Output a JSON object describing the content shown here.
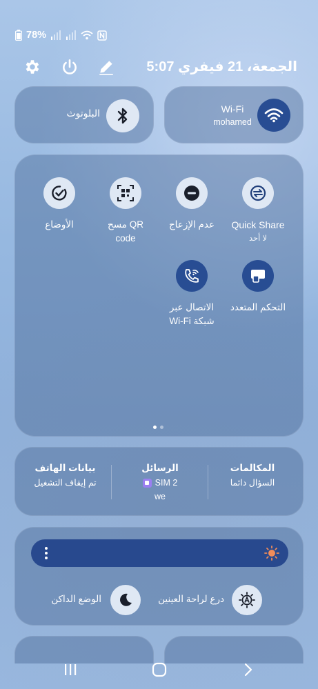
{
  "status_bar": {
    "battery": "78%",
    "icons": [
      "battery-icon",
      "signal-icon",
      "signal-icon",
      "wifi-icon",
      "nfc-icon"
    ]
  },
  "header": {
    "datetime": "5:07 الجمعة، 21 فيفري",
    "icons": [
      "settings-icon",
      "power-icon",
      "edit-icon"
    ]
  },
  "wifi_tile": {
    "label": "Wi-Fi",
    "network": "mohamed",
    "icon": "wifi-icon"
  },
  "bluetooth_tile": {
    "label": "البلوتوث",
    "icon": "bluetooth-icon"
  },
  "tiles": [
    {
      "label": "Quick Share",
      "sub": "لا أحد",
      "icon": "quick-share-icon"
    },
    {
      "label": "عدم الإزعاج",
      "icon": "do-not-disturb-icon"
    },
    {
      "label": "مسح QR",
      "label2": "code",
      "icon": "qr-code-icon"
    },
    {
      "label": "الأوضاع",
      "icon": "modes-icon"
    },
    {
      "label": "التحكم المتعدد",
      "icon": "multi-control-icon"
    },
    {
      "label": "الاتصال عبر",
      "label2": "Wi-Fi شبكة",
      "icon": "wifi-calling-icon"
    }
  ],
  "pagination": {
    "pages": 2,
    "current": 1
  },
  "sim": {
    "calls": {
      "title": "المكالمات",
      "value": "السؤال دائما"
    },
    "messages": {
      "title": "الرسائل",
      "value": "SIM 2",
      "sub": "we"
    },
    "data": {
      "title": "بيانات الهاتف",
      "value": "تم إيقاف التشغيل"
    }
  },
  "brightness": {
    "level": 0.0,
    "icons": [
      "more-options-icon",
      "sun-icon"
    ]
  },
  "eye_comfort": {
    "label": "درع لراحة العينين"
  },
  "dark_mode": {
    "label": "الوضع الداكن"
  },
  "nav": {
    "icons": [
      "recents-icon",
      "home-icon",
      "back-icon"
    ]
  },
  "colors": {
    "accent": "#284d93",
    "icon_light": "#dfe8f4",
    "sun": "#f08c5a"
  }
}
